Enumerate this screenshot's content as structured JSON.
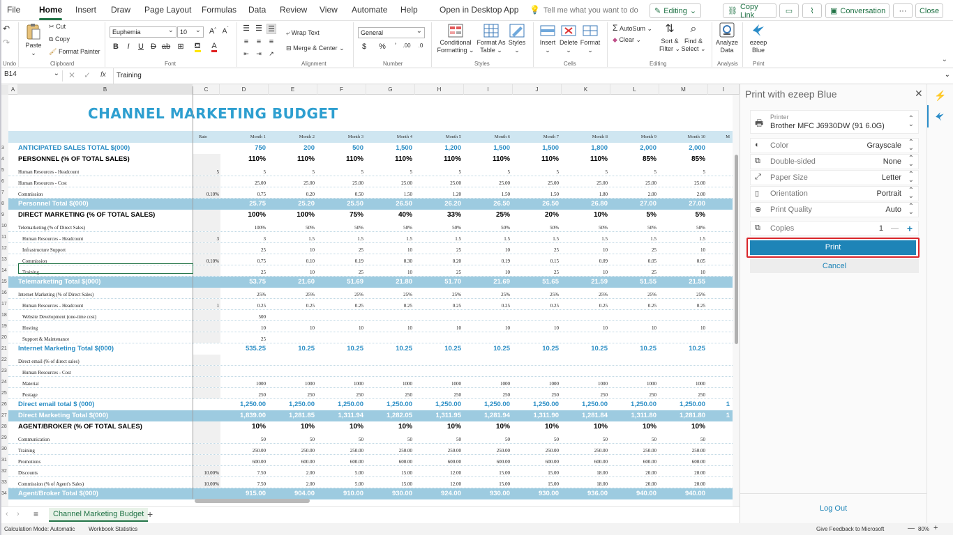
{
  "menu": {
    "tabs": [
      "File",
      "Home",
      "Insert",
      "Draw",
      "Page Layout",
      "Formulas",
      "Data",
      "Review",
      "View",
      "Automate",
      "Help"
    ],
    "active_tab": "Home",
    "open_desktop": "Open in Desktop App",
    "tell_me": "Tell me what you want to do",
    "editing": "Editing",
    "copy_link": "Copy Link",
    "conversation": "Conversation",
    "more": "···",
    "close": "Close"
  },
  "ribbon": {
    "undo_group": "Undo",
    "paste": "Paste",
    "cut": "Cut",
    "copy": "Copy",
    "format_painter": "Format Painter",
    "clipboard": "Clipboard",
    "font_name": "Euphemia",
    "font_size": "10",
    "font_group": "Font",
    "wrap_text": "Wrap Text",
    "merge_center": "Merge & Center",
    "alignment": "Alignment",
    "number_format": "General",
    "number": "Number",
    "conditional_formatting": [
      "Conditional",
      "Formatting"
    ],
    "format_as_table": [
      "Format As",
      "Table"
    ],
    "styles_btn": "Styles",
    "styles_group": "Styles",
    "insert": "Insert",
    "delete": "Delete",
    "format": "Format",
    "cells": "Cells",
    "autosum": "AutoSum",
    "clear": "Clear",
    "sort_filter": [
      "Sort &",
      "Filter"
    ],
    "find_select": [
      "Find &",
      "Select"
    ],
    "editing_group": "Editing",
    "analyze_data": [
      "Analyze",
      "Data"
    ],
    "analysis": "Analysis",
    "ezeep_blue": [
      "ezeep",
      "Blue"
    ],
    "print_group": "Print"
  },
  "formula_bar": {
    "name_box": "B14",
    "fx": "fx",
    "value": "Training"
  },
  "sheet": {
    "title": "CHANNEL MARKETING BUDGET",
    "columns": [
      "A",
      "B",
      "C",
      "D",
      "E",
      "F",
      "G",
      "H",
      "I",
      "J",
      "K",
      "L",
      "M"
    ],
    "header_row": {
      "label": "",
      "rate": "Rate",
      "months": [
        "Month 1",
        "Month 2",
        "Month 3",
        "Month 4",
        "Month 5",
        "Month 6",
        "Month 7",
        "Month 8",
        "Month 9",
        "Month 10",
        "M"
      ]
    },
    "rows": [
      {
        "n": "3",
        "type": "sales",
        "label": "ANTICIPATED SALES TOTAL $(000)",
        "rate": "",
        "v": [
          "750",
          "200",
          "500",
          "1,500",
          "1,200",
          "1,500",
          "1,500",
          "1,800",
          "2,000",
          "2,000",
          ""
        ]
      },
      {
        "n": "4",
        "type": "hdr",
        "label": "PERSONNEL (% OF TOTAL SALES)",
        "rate": "",
        "v": [
          "110%",
          "110%",
          "110%",
          "110%",
          "110%",
          "110%",
          "110%",
          "110%",
          "85%",
          "85%",
          ""
        ]
      },
      {
        "n": "5",
        "type": "normal",
        "label": "Human Resources - Headcount",
        "rate": "5",
        "v": [
          "5",
          "5",
          "5",
          "5",
          "5",
          "5",
          "5",
          "5",
          "5",
          "5",
          ""
        ]
      },
      {
        "n": "6",
        "type": "normal",
        "label": "Human Resources - Cost",
        "rate": "",
        "v": [
          "25.00",
          "25.00",
          "25.00",
          "25.00",
          "25.00",
          "25.00",
          "25.00",
          "25.00",
          "25.00",
          "25.00",
          ""
        ]
      },
      {
        "n": "7",
        "type": "normal",
        "label": "Commission",
        "rate": "0.10%",
        "v": [
          "0.75",
          "0.20",
          "0.50",
          "1.50",
          "1.20",
          "1.50",
          "1.50",
          "1.80",
          "2.00",
          "2.00",
          ""
        ]
      },
      {
        "n": "8",
        "type": "total",
        "label": "Personnel Total $(000)",
        "rate": "",
        "v": [
          "25.75",
          "25.20",
          "25.50",
          "26.50",
          "26.20",
          "26.50",
          "26.50",
          "26.80",
          "27.00",
          "27.00",
          ""
        ]
      },
      {
        "n": "9",
        "type": "hdr",
        "label": "DIRECT MARKETING (% OF TOTAL SALES)",
        "rate": "",
        "v": [
          "100%",
          "100%",
          "75%",
          "40%",
          "33%",
          "25%",
          "20%",
          "10%",
          "5%",
          "5%",
          ""
        ]
      },
      {
        "n": "10",
        "type": "normal",
        "label": "Telemarketing (% of Direct Sales)",
        "rate": "",
        "v": [
          "100%",
          "50%",
          "50%",
          "50%",
          "50%",
          "50%",
          "50%",
          "50%",
          "50%",
          "50%",
          ""
        ]
      },
      {
        "n": "11",
        "type": "normal sub",
        "label": "Human Resources - Headcount",
        "rate": "3",
        "v": [
          "3",
          "1.5",
          "1.5",
          "1.5",
          "1.5",
          "1.5",
          "1.5",
          "1.5",
          "1.5",
          "1.5",
          ""
        ]
      },
      {
        "n": "12",
        "type": "normal sub",
        "label": "Infrastructure Support",
        "rate": "",
        "v": [
          "25",
          "10",
          "25",
          "10",
          "25",
          "10",
          "25",
          "10",
          "25",
          "10",
          ""
        ]
      },
      {
        "n": "13",
        "type": "normal sub",
        "label": "Commission",
        "rate": "0.10%",
        "v": [
          "0.75",
          "0.10",
          "0.19",
          "0.30",
          "0.20",
          "0.19",
          "0.15",
          "0.09",
          "0.05",
          "0.05",
          ""
        ]
      },
      {
        "n": "14",
        "type": "normal sub",
        "label": "Training",
        "rate": "",
        "v": [
          "25",
          "10",
          "25",
          "10",
          "25",
          "10",
          "25",
          "10",
          "25",
          "10",
          ""
        ]
      },
      {
        "n": "15",
        "type": "total",
        "label": "Telemarketing Total $(000)",
        "rate": "",
        "v": [
          "53.75",
          "21.60",
          "51.69",
          "21.80",
          "51.70",
          "21.69",
          "51.65",
          "21.59",
          "51.55",
          "21.55",
          ""
        ]
      },
      {
        "n": "16",
        "type": "normal",
        "label": "Internet Marketing (% of Direct Sales)",
        "rate": "",
        "v": [
          "25%",
          "25%",
          "25%",
          "25%",
          "25%",
          "25%",
          "25%",
          "25%",
          "25%",
          "25%",
          ""
        ]
      },
      {
        "n": "17",
        "type": "normal sub",
        "label": "Human Resources - Headcount",
        "rate": "1",
        "v": [
          "0.25",
          "0.25",
          "0.25",
          "0.25",
          "0.25",
          "0.25",
          "0.25",
          "0.25",
          "0.25",
          "0.25",
          ""
        ]
      },
      {
        "n": "18",
        "type": "normal sub",
        "label": "Website Development (one-time cost)",
        "rate": "",
        "v": [
          "500",
          "",
          "",
          "",
          "",
          "",
          "",
          "",
          "",
          "",
          ""
        ]
      },
      {
        "n": "19",
        "type": "normal sub",
        "label": "Hosting",
        "rate": "",
        "v": [
          "10",
          "10",
          "10",
          "10",
          "10",
          "10",
          "10",
          "10",
          "10",
          "10",
          ""
        ]
      },
      {
        "n": "20",
        "type": "normal sub",
        "label": "Support & Maintenance",
        "rate": "",
        "v": [
          "25",
          "",
          "",
          "",
          "",
          "",
          "",
          "",
          "",
          "",
          ""
        ]
      },
      {
        "n": "21",
        "type": "sales",
        "label": "Internet Marketing Total $(000)",
        "rate": "",
        "v": [
          "535.25",
          "10.25",
          "10.25",
          "10.25",
          "10.25",
          "10.25",
          "10.25",
          "10.25",
          "10.25",
          "10.25",
          ""
        ]
      },
      {
        "n": "22",
        "type": "normal",
        "label": "Direct email (% of direct sales)",
        "rate": "",
        "v": [
          "",
          "",
          "",
          "",
          "",
          "",
          "",
          "",
          "",
          "",
          ""
        ]
      },
      {
        "n": "23",
        "type": "normal sub",
        "label": "Human Resources - Cost",
        "rate": "",
        "v": [
          "",
          "",
          "",
          "",
          "",
          "",
          "",
          "",
          "",
          "",
          ""
        ]
      },
      {
        "n": "24",
        "type": "normal sub",
        "label": "Material",
        "rate": "",
        "v": [
          "1000",
          "1000",
          "1000",
          "1000",
          "1000",
          "1000",
          "1000",
          "1000",
          "1000",
          "1000",
          ""
        ]
      },
      {
        "n": "25",
        "type": "normal sub",
        "label": "Postage",
        "rate": "",
        "v": [
          "250",
          "250",
          "250",
          "250",
          "250",
          "250",
          "250",
          "250",
          "250",
          "250",
          ""
        ]
      },
      {
        "n": "26",
        "type": "sales",
        "label": "Direct email total $ (000)",
        "rate": "",
        "v": [
          "1,250.00",
          "1,250.00",
          "1,250.00",
          "1,250.00",
          "1,250.00",
          "1,250.00",
          "1,250.00",
          "1,250.00",
          "1,250.00",
          "1,250.00",
          "1"
        ]
      },
      {
        "n": "27",
        "type": "total",
        "label": "Direct Marketing Total $(000)",
        "rate": "",
        "v": [
          "1,839.00",
          "1,281.85",
          "1,311.94",
          "1,282.05",
          "1,311.95",
          "1,281.94",
          "1,311.90",
          "1,281.84",
          "1,311.80",
          "1,281.80",
          "1"
        ]
      },
      {
        "n": "28",
        "type": "hdr",
        "label": "AGENT/BROKER (% OF TOTAL SALES)",
        "rate": "",
        "v": [
          "10%",
          "10%",
          "10%",
          "10%",
          "10%",
          "10%",
          "10%",
          "10%",
          "10%",
          "10%",
          ""
        ]
      },
      {
        "n": "29",
        "type": "normal",
        "label": "Communication",
        "rate": "",
        "v": [
          "50",
          "50",
          "50",
          "50",
          "50",
          "50",
          "50",
          "50",
          "50",
          "50",
          ""
        ]
      },
      {
        "n": "30",
        "type": "normal",
        "label": "Training",
        "rate": "",
        "v": [
          "250.00",
          "250.00",
          "250.00",
          "250.00",
          "250.00",
          "250.00",
          "250.00",
          "250.00",
          "250.00",
          "250.00",
          ""
        ]
      },
      {
        "n": "31",
        "type": "normal",
        "label": "Promotions",
        "rate": "",
        "v": [
          "600.00",
          "600.00",
          "600.00",
          "600.00",
          "600.00",
          "600.00",
          "600.00",
          "600.00",
          "600.00",
          "600.00",
          ""
        ]
      },
      {
        "n": "32",
        "type": "normal",
        "label": "Discounts",
        "rate": "10.00%",
        "v": [
          "7.50",
          "2.00",
          "5.00",
          "15.00",
          "12.00",
          "15.00",
          "15.00",
          "18.00",
          "20.00",
          "20.00",
          ""
        ]
      },
      {
        "n": "33",
        "type": "normal",
        "label": "Commission (% of Agent's Sales)",
        "rate": "10.00%",
        "v": [
          "7.50",
          "2.00",
          "5.00",
          "15.00",
          "12.00",
          "15.00",
          "15.00",
          "18.00",
          "20.00",
          "20.00",
          ""
        ]
      },
      {
        "n": "34",
        "type": "total",
        "label": "Agent/Broker Total $(000)",
        "rate": "",
        "v": [
          "915.00",
          "904.00",
          "910.00",
          "930.00",
          "924.00",
          "930.00",
          "930.00",
          "936.00",
          "940.00",
          "940.00",
          ""
        ]
      }
    ]
  },
  "sheet_tabs": {
    "active": "Channel Marketing Budget"
  },
  "status": {
    "calc_mode": "Calculation Mode: Automatic",
    "stats": "Workbook Statistics",
    "feedback": "Give Feedback to Microsoft",
    "zoom": "80%"
  },
  "pane": {
    "title": "Print with ezeep Blue",
    "printer_label": "Printer",
    "printer_name": "Brother MFC J6930DW (91 6.0G)",
    "options": [
      {
        "label": "Color",
        "value": "Grayscale"
      },
      {
        "label": "Double-sided",
        "value": "None"
      },
      {
        "label": "Paper Size",
        "value": "Letter"
      },
      {
        "label": "Orientation",
        "value": "Portrait"
      },
      {
        "label": "Print Quality",
        "value": "Auto"
      }
    ],
    "copies_label": "Copies",
    "copies_value": "1",
    "print": "Print",
    "cancel": "Cancel",
    "logout": "Log Out"
  },
  "colors": {
    "accent_green": "#217346",
    "print_btn": "#1e84b7",
    "title_blue": "#2e9fd0",
    "total_band": "#9dcbe0",
    "highlight_red": "#d9262b"
  }
}
